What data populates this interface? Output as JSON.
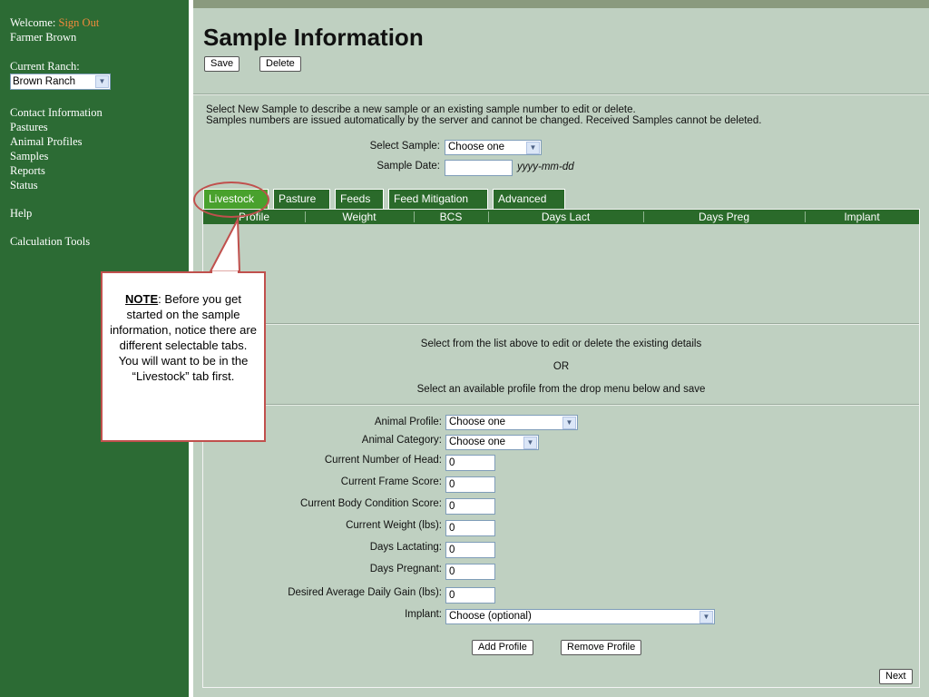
{
  "sidebar": {
    "welcome": "Welcome:",
    "sign_out": "Sign Out",
    "user": "Farmer Brown",
    "current_ranch_label": "Current Ranch:",
    "ranch_value": "Brown Ranch",
    "nav": [
      "Contact Information",
      "Pastures",
      "Animal Profiles",
      "Samples",
      "Reports",
      "Status"
    ],
    "help": "Help",
    "calc": "Calculation Tools"
  },
  "page": {
    "title": "Sample Information",
    "save": "Save",
    "delete": "Delete",
    "intro1": "Select New Sample to describe a new sample or an existing sample number to edit or delete.",
    "intro2": "Samples numbers are issued automatically by the server and cannot be changed. Received Samples cannot be deleted.",
    "select_sample_label": "Select Sample:",
    "select_sample_value": "Choose one",
    "sample_date_label": "Sample Date:",
    "sample_date_value": "",
    "date_hint": "yyyy-mm-dd"
  },
  "tabs": [
    "Livestock",
    "Pasture",
    "Feeds",
    "Feed Mitigation",
    "Advanced"
  ],
  "table": {
    "columns": [
      "Profile",
      "Weight",
      "BCS",
      "Days Lact",
      "Days Preg",
      "Implant"
    ]
  },
  "detail": {
    "msg1": "Select from the list above to edit or delete the existing details",
    "msg_or": "OR",
    "msg2": "Select an available profile from the drop menu below and save",
    "fields": [
      {
        "label": "Animal Profile:",
        "value": "Choose one"
      },
      {
        "label": "Animal Category:",
        "value": "Choose one"
      },
      {
        "label": "Current Number of Head:",
        "value": "0"
      },
      {
        "label": "Current Frame Score:",
        "value": "0"
      },
      {
        "label": "Current Body Condition Score:",
        "value": "0"
      },
      {
        "label": "Current Weight (lbs):",
        "value": "0"
      },
      {
        "label": "Days Lactating:",
        "value": "0"
      },
      {
        "label": "Days Pregnant:",
        "value": "0"
      },
      {
        "label": "Desired Average Daily Gain (lbs):",
        "value": "0"
      },
      {
        "label": "Implant:",
        "value": "Choose (optional)"
      }
    ],
    "add_profile": "Add Profile",
    "remove_profile": "Remove Profile",
    "next": "Next"
  },
  "note": {
    "heading": "NOTE",
    "text": ":  Before you get started on the sample information, notice there are different selectable tabs.  You will want to be in the “Livestock” tab first."
  },
  "colors": {
    "sidebar": "#2c6b34",
    "panel": "#bfd0c1",
    "tab": "#2a6a2a",
    "tab_active": "#49a12d",
    "callout": "#c0504d",
    "sign_out": "#f08a3c"
  }
}
